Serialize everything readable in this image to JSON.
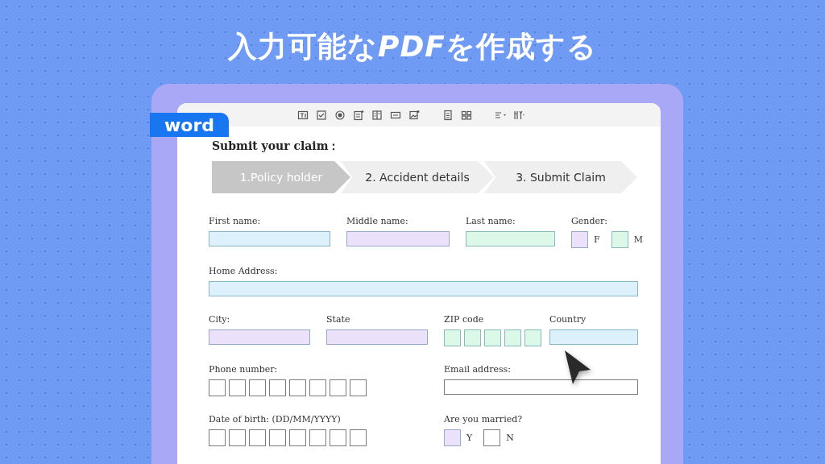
{
  "headline": [
    {
      "text": "入力可能な",
      "italic": false
    },
    {
      "text": "PDF",
      "italic": true
    },
    {
      "text": "を作成する",
      "italic": false
    }
  ],
  "badge": "word",
  "form": {
    "title": "Submit your claim：",
    "steps": [
      {
        "label": "1.Policy holder",
        "selected": true
      },
      {
        "label": "2. Accident details",
        "selected": false
      },
      {
        "label": "3. Submit Claim",
        "selected": false
      }
    ],
    "rows": [
      {
        "fields": [
          {
            "kind": "text",
            "label": "First name:",
            "color": "#dcf1fb"
          },
          {
            "kind": "text",
            "label": "Middle name:",
            "color": "#ebe1fb"
          },
          {
            "kind": "text",
            "label": "Last name:",
            "color": "#dcf8e9"
          },
          {
            "kind": "choice",
            "label": "Gender:",
            "options": [
              {
                "label": "F",
                "color": "#ebe1fb"
              },
              {
                "label": "M",
                "color": "#dcf8e9"
              }
            ]
          }
        ]
      },
      {
        "fields": [
          {
            "kind": "text",
            "label": "Home Address:",
            "color": "#dcf1fb"
          }
        ]
      },
      {
        "fields": [
          {
            "kind": "text",
            "label": "City:",
            "color": "#ebe1fb"
          },
          {
            "kind": "text",
            "label": "State",
            "color": "#ebe1fb"
          },
          {
            "kind": "boxes",
            "label": "ZIP code",
            "boxes": [
              {
                "color": "#dcf8e9"
              },
              {
                "color": "#dcf8e9"
              },
              {
                "color": "#dcf8e9"
              },
              {
                "color": "#dcf8e9"
              },
              {
                "color": "#dcf8e9"
              }
            ]
          },
          {
            "kind": "text",
            "label": "Country",
            "color": "#dcf1fb"
          }
        ]
      },
      {
        "fields": [
          {
            "kind": "boxes",
            "label": "Phone number:",
            "boxes": [
              {
                "color": "#ffffff"
              },
              {
                "color": "#ffffff"
              },
              {
                "color": "#ffffff"
              },
              {
                "color": "#ffffff"
              },
              {
                "color": "#ffffff"
              },
              {
                "color": "#ffffff"
              },
              {
                "color": "#ffffff"
              },
              {
                "color": "#ffffff"
              }
            ]
          },
          {
            "kind": "text",
            "label": "Email address:",
            "color": "#ffffff"
          }
        ]
      },
      {
        "fields": [
          {
            "kind": "boxes",
            "label": "Date of birth: (DD/MM/YYYY)",
            "boxes": [
              {
                "color": "#ffffff"
              },
              {
                "color": "#ffffff"
              },
              {
                "color": "#ffffff"
              },
              {
                "color": "#ffffff"
              },
              {
                "color": "#ffffff"
              },
              {
                "color": "#ffffff"
              },
              {
                "color": "#ffffff"
              },
              {
                "color": "#ffffff"
              }
            ]
          },
          {
            "kind": "choice",
            "label": "Are you married?",
            "options": [
              {
                "label": "Y",
                "color": "#ebe1fb"
              },
              {
                "label": "N",
                "color": "#ffffff"
              }
            ]
          }
        ]
      }
    ]
  }
}
